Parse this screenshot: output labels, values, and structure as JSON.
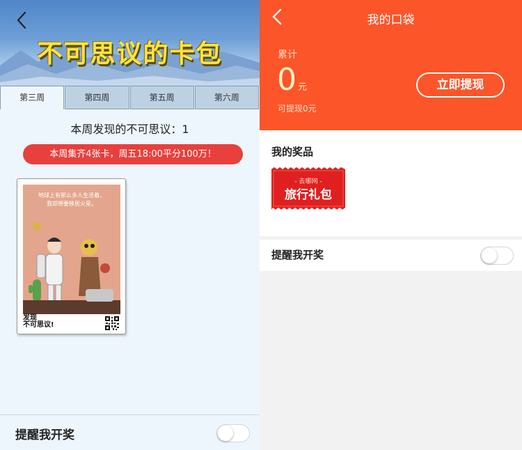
{
  "left": {
    "banner_title": "不可思议的卡包",
    "tabs": [
      {
        "label": "第三周",
        "active": true
      },
      {
        "label": "第四周",
        "active": false
      },
      {
        "label": "第五周",
        "active": false
      },
      {
        "label": "第六周",
        "active": false
      }
    ],
    "subtitle": "本周发现的不可思议：1",
    "notice": "本周集齐4张卡，周五18:00平分100万！",
    "card": {
      "caption_line1": "地球上有那么多人生活着，",
      "caption_line2": "我却想要移居火星。",
      "brand_line1": "发现",
      "brand_line2": "不可思议!"
    },
    "remind_label": "提醒我开奖",
    "remind_on": false
  },
  "right": {
    "title": "我的口袋",
    "accumulated_label": "累计",
    "amount": "0",
    "amount_unit": "元",
    "withdrawable": "可提现0元",
    "withdraw_button": "立即提现",
    "prizes_heading": "我的奖品",
    "coupon_top": "- 去哪网 -",
    "coupon_main": "旅行礼包",
    "remind_label": "提醒我开奖",
    "remind_on": false
  },
  "colors": {
    "accent_orange": "#fc5529",
    "notice_red": "#e8403d",
    "banner_title_yellow": "#ffe53a",
    "coupon_red": "#e02020"
  },
  "icons": [
    "back-arrow-icon",
    "qr-code-icon"
  ]
}
